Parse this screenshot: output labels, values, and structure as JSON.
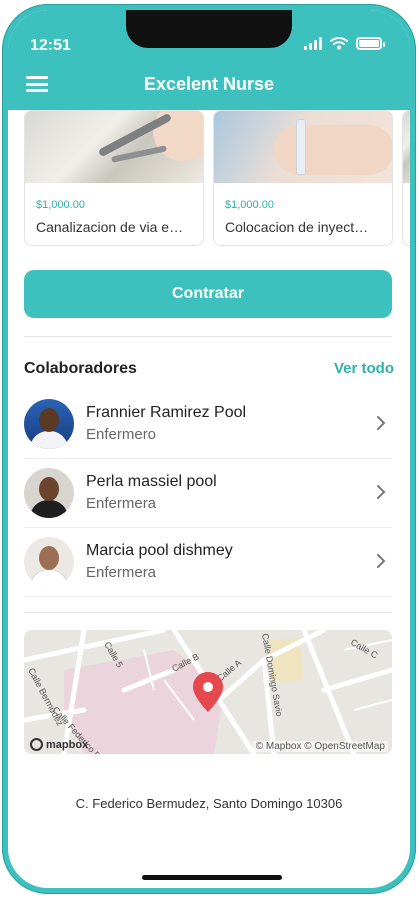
{
  "status_bar": {
    "time": "12:51"
  },
  "header": {
    "title": "Excelent Nurse"
  },
  "services": [
    {
      "price": "$1,000.00",
      "name": "Canalizacion de via e…"
    },
    {
      "price": "$1,000.00",
      "name": "Colocacion de inyect…"
    }
  ],
  "hire_button": {
    "label": "Contratar"
  },
  "collaborators": {
    "title": "Colaboradores",
    "see_all": "Ver todo",
    "items": [
      {
        "name": "Frannier Ramirez Pool",
        "role": "Enfermero"
      },
      {
        "name": "Perla massiel pool",
        "role": "Enfermera"
      },
      {
        "name": "Marcia pool dishmey",
        "role": "Enfermera"
      }
    ]
  },
  "map": {
    "streets": [
      "Calle B",
      "Calle A",
      "Calle 5",
      "Calle C",
      "Calle Domingo Savio",
      "Calle Bermudez",
      "Calle Federico Bermudez"
    ],
    "logo": "mapbox",
    "credit": "© Mapbox © OpenStreetMap"
  },
  "address": "C. Federico Bermudez, Santo Domingo 10306",
  "colors": {
    "accent": "#3cc1be",
    "price": "#2fb0ad",
    "pin": "#e5484d"
  }
}
